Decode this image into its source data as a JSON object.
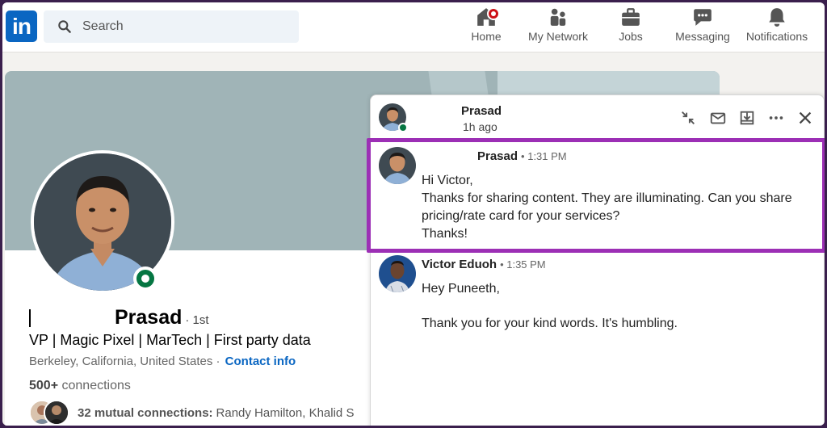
{
  "nav": {
    "logo": "in",
    "search_placeholder": "Search",
    "items": [
      {
        "label": "Home",
        "icon": "home-icon",
        "badge": true
      },
      {
        "label": "My Network",
        "icon": "network-icon",
        "badge": false
      },
      {
        "label": "Jobs",
        "icon": "jobs-icon",
        "badge": false
      },
      {
        "label": "Messaging",
        "icon": "messaging-icon",
        "badge": false
      },
      {
        "label": "Notifications",
        "icon": "bell-icon",
        "badge": false
      }
    ]
  },
  "profile": {
    "name": "Prasad",
    "degree": "· 1st",
    "headline": "VP | Magic Pixel | MarTech | First party data",
    "location": "Berkeley, California, United States ·",
    "contact_link": "Contact info",
    "connections_count": "500+",
    "connections_label": " connections",
    "mutual_bold": "32 mutual connections:",
    "mutual_names": "Randy Hamilton, Khalid S"
  },
  "chat": {
    "header": {
      "name": "Prasad",
      "time": "1h ago"
    },
    "header_actions": [
      "compress-icon",
      "envelope-icon",
      "archive-icon",
      "more-icon",
      "close-icon"
    ],
    "messages": [
      {
        "sender": "Prasad",
        "time": "• 1:31 PM",
        "lines": [
          "Hi Victor,",
          "Thanks for sharing content. They are illuminating. Can you share",
          "pricing/rate card for your services?",
          "Thanks!"
        ]
      },
      {
        "sender": "Victor Eduoh",
        "time": "• 1:35 PM",
        "lines": [
          "Hey Puneeth,",
          "",
          "Thank you for your kind words. It's humbling."
        ]
      }
    ]
  },
  "colors": {
    "brand": "#0a66c2",
    "highlight": "#9c2fb5",
    "online": "#057642",
    "badge": "#cc1016"
  }
}
